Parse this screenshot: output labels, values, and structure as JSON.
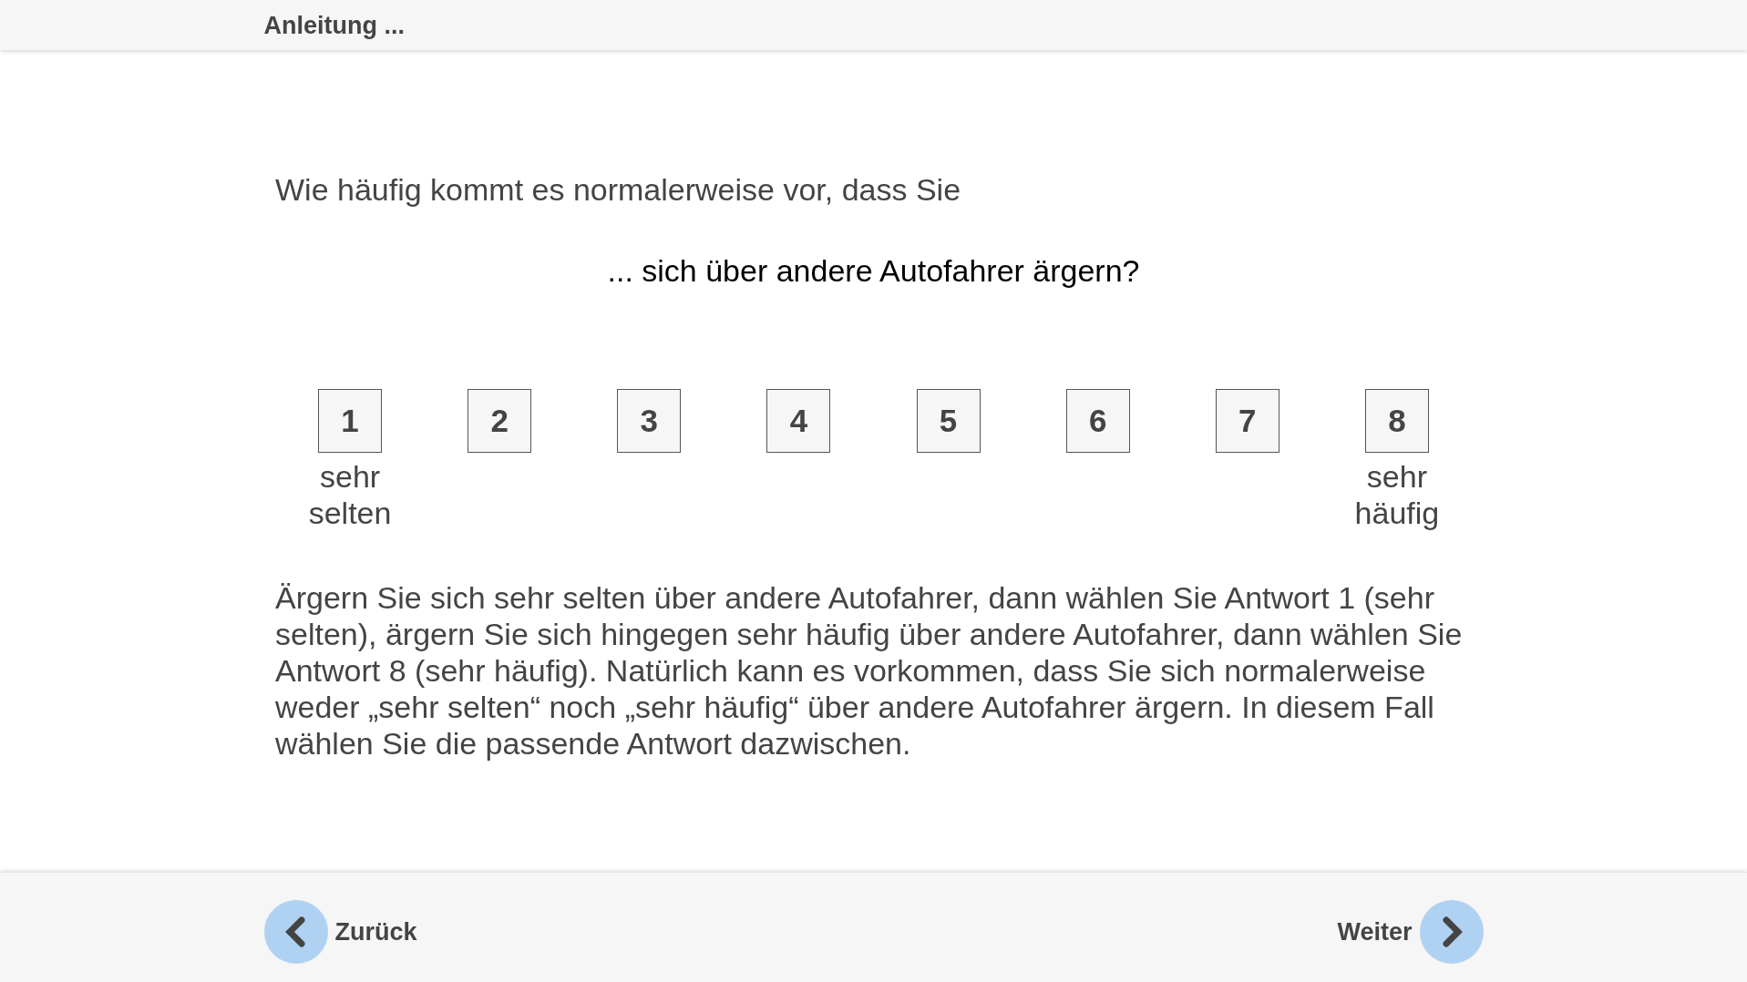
{
  "header": {
    "title": "Anleitung ..."
  },
  "question": {
    "intro": "Wie häufig kommt es normalerweise vor, dass Sie",
    "item": "... sich über andere Autofahrer ärgern?"
  },
  "scale": {
    "options": [
      {
        "value": "1",
        "label": "sehr selten",
        "selected": false
      },
      {
        "value": "2",
        "selected": false
      },
      {
        "value": "3",
        "selected": false
      },
      {
        "value": "4",
        "selected": false
      },
      {
        "value": "5",
        "selected": false
      },
      {
        "value": "6",
        "selected": false
      },
      {
        "value": "7",
        "selected": false
      },
      {
        "value": "8",
        "label": "sehr häufig",
        "selected": false
      }
    ]
  },
  "explanation": "Ärgern Sie sich sehr selten über andere Autofahrer, dann wählen Sie Antwort 1 (sehr selten), ärgern Sie sich hingegen sehr häufig über andere Autofahrer, dann wählen Sie Antwort 8 (sehr häufig). Natürlich kann es vorkommen, dass Sie sich normalerweise weder „sehr selten“ noch „sehr häufig“ über andere Autofahrer ärgern. In diesem Fall wählen Sie die passende Antwort dazwischen.",
  "navigation": {
    "back": {
      "label": "Zurück"
    },
    "next": {
      "label": "Weiter"
    }
  }
}
